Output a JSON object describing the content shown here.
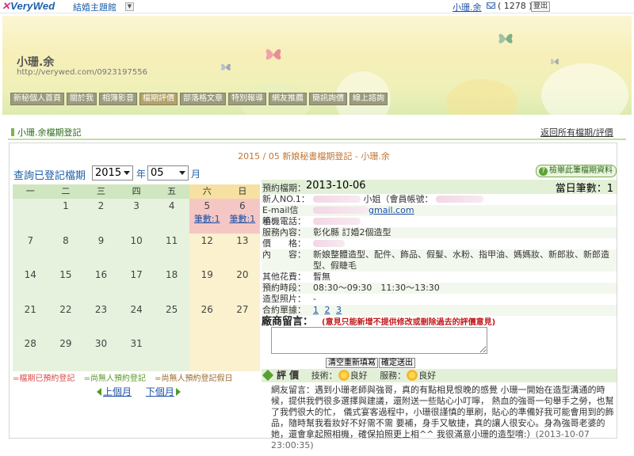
{
  "topbar": {
    "logo": "VeryWed",
    "site_name": "結婚主題館",
    "user_name": "小珊.余",
    "mail_count": "( 1278 )",
    "logout_label": "登出"
  },
  "banner": {
    "name": "小珊.余",
    "url": "http://verywed.com/0923197556",
    "nav": [
      "新秘個人首頁",
      "關於我",
      "相簿影音",
      "檔期評價",
      "部落格文章",
      "特別報導",
      "網友推薦",
      "簡訊詢價",
      "線上諮詢"
    ],
    "active_nav": 3
  },
  "page": {
    "heading": "小珊.余檔期登記",
    "back_link": "返回所有檔期/評價",
    "main_title": "2015 / 05 新娘秘書檔期登記 - 小珊.余"
  },
  "calendar": {
    "query_label": "查詢已登記檔期",
    "year": "2015",
    "year_unit": "年",
    "month": "05",
    "month_unit": "月",
    "weekdays": [
      "一",
      "二",
      "三",
      "四",
      "五",
      "六",
      "日"
    ],
    "weeks": [
      [
        {
          "d": ""
        },
        {
          "d": "1"
        },
        {
          "d": "2"
        },
        {
          "d": "3"
        },
        {
          "d": "4"
        },
        {
          "d": "5",
          "booked": true,
          "count": "筆數:1"
        },
        {
          "d": "6",
          "booked": true,
          "count": "筆數:1"
        }
      ],
      [
        {
          "d": "7"
        },
        {
          "d": "8"
        },
        {
          "d": "9"
        },
        {
          "d": "10"
        },
        {
          "d": "11"
        },
        {
          "d": "12"
        },
        {
          "d": "13"
        }
      ],
      [
        {
          "d": "14"
        },
        {
          "d": "15"
        },
        {
          "d": "16"
        },
        {
          "d": "17"
        },
        {
          "d": "18"
        },
        {
          "d": "19"
        },
        {
          "d": "20"
        }
      ],
      [
        {
          "d": "21"
        },
        {
          "d": "22"
        },
        {
          "d": "23"
        },
        {
          "d": "24"
        },
        {
          "d": "25"
        },
        {
          "d": "26"
        },
        {
          "d": "27"
        }
      ],
      [
        {
          "d": "28"
        },
        {
          "d": "29"
        },
        {
          "d": "30"
        },
        {
          "d": "31"
        },
        {
          "d": ""
        },
        {
          "d": ""
        },
        {
          "d": ""
        }
      ]
    ],
    "legend": [
      "=檔期已預約登記",
      "=尚無人預約登記",
      "=尚無人預約登記假日"
    ],
    "prev": "上個月",
    "next": "下個月"
  },
  "detail": {
    "check_button": "檢舉此筆檔期資料",
    "date_label": "預約檔期：",
    "date": "2013-10-06",
    "daycount": "當日筆數：1",
    "newcomer_label": "新人NO.1：",
    "newcomer_value": "小姐（會員帳號：",
    "email_label": "E-mail信箱：",
    "email_value": "gmail.com",
    "phone_label": "手機電話：",
    "service_label": "服務內容：",
    "service_value": "彰化縣 訂婚2個造型",
    "price_label": "價　　格：",
    "content_label": "內　　容：",
    "content_value": "新娘整體造型、配件、飾品、假髮、水粉、指甲油、媽媽妝、新郎妝、新郎造型、假睫毛",
    "other_fee_label": "其他花費：",
    "other_fee_value": "暫無",
    "time_label": "預約時段：",
    "time_value": "08:30～09:30　11:30～13:30",
    "photo_label": "造型照片：",
    "photo_value": "-",
    "contract_label": "合約單據：",
    "contract_links": [
      "1",
      "2",
      "3"
    ]
  },
  "message": {
    "label": "廠商留言：",
    "note": "(意見只能新增不提供修改或刪除過去的評價意見)",
    "clear_button": "清空重新填寫",
    "submit_button": "確定送出"
  },
  "evaluation": {
    "title": "評 價",
    "skill_label": "技術：",
    "skill_value": "良好",
    "service_label": "服務：",
    "service_value": "良好",
    "review_text": "網友留言：遇到小珊老師與強哥，真的有點相見恨晚的感覺 小珊一開始在造型溝通的時候，提供我們很多選擇與建議，還附送一些貼心小叮嚀， 熱血的強哥一句舉手之勞，也幫了我們很大的忙， 儀式宴客過程中，小珊很謹慎的單刷，貼心的準備好我可能會用到的飾品，隨時幫我看妝好不好需不需 要補，身手又敏捷，真的讓人很安心。身為強哥老婆的她，還會拿起照相機，確保拍照更上相^^ 我很滿意小珊的造型唷:）",
    "review_time": "(2013-10-07 23:00:35)"
  }
}
